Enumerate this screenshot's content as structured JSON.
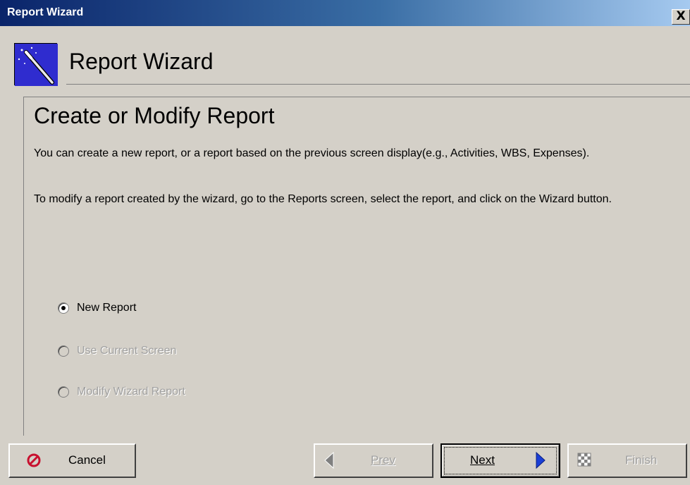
{
  "window": {
    "title": "Report Wizard",
    "close_label": "X"
  },
  "header": {
    "title": "Report Wizard"
  },
  "panel": {
    "title": "Create or Modify Report",
    "description_1": "You can create a new report, or a report based on the previous screen display(e.g., Activities, WBS, Expenses).",
    "description_2": "To modify a report created by the wizard, go to the Reports screen, select the report, and click on the Wizard button."
  },
  "options": [
    {
      "label": "New Report",
      "selected": true,
      "enabled": true
    },
    {
      "label": "Use Current Screen",
      "selected": false,
      "enabled": false
    },
    {
      "label": "Modify Wizard Report",
      "selected": false,
      "enabled": false
    }
  ],
  "buttons": {
    "cancel": "Cancel",
    "prev": "Prev",
    "next": "Next",
    "finish": "Finish"
  },
  "colors": {
    "titlebar_start": "#0a246a",
    "titlebar_end": "#a6caf0",
    "face": "#d4d0c8",
    "cancel_icon": "#c8102e",
    "arrow_enabled": "#1a3fd6",
    "arrow_disabled": "#808080"
  }
}
